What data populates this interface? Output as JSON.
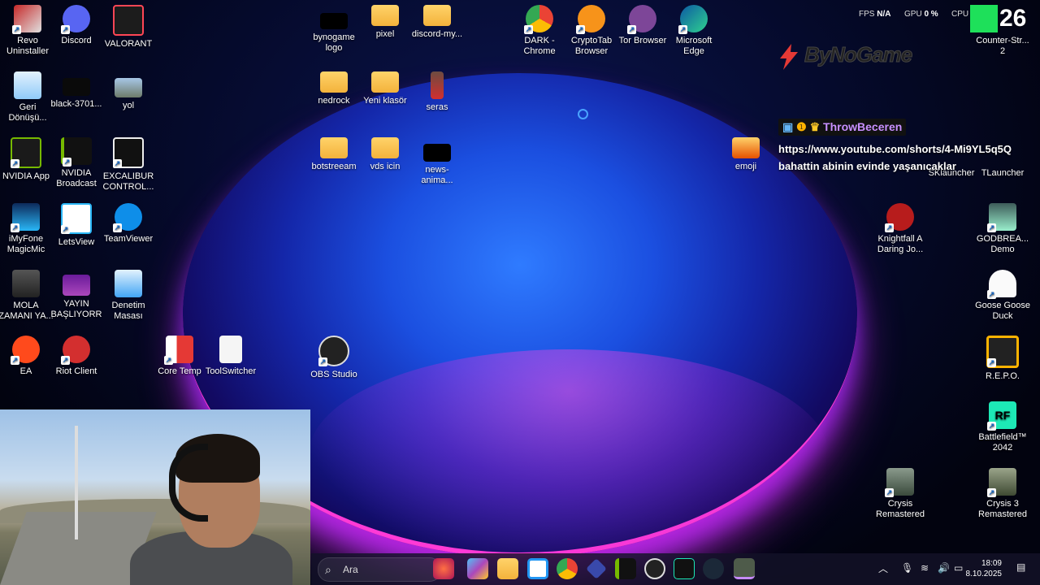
{
  "hud": {
    "fps_label": "FPS",
    "fps_value": "N/A",
    "gpu_label": "GPU",
    "gpu_value": "0 %",
    "cpu_label": "CPU",
    "counter_value": "26"
  },
  "brand": {
    "text": "ByNoGame"
  },
  "chat": {
    "username": "ThrowBeceren",
    "message_line1": "https://www.youtube.com/shorts/4-Mi9YL5q5Q",
    "message_line2": "bahattin abinin evinde yaşanıcaklar"
  },
  "desktop_icons": {
    "revo": "Revo\nUninstaller",
    "discord": "Discord",
    "valorant": "VALORANT",
    "recycle": "Geri\nDönüşü...",
    "black": "black-3701...",
    "yol": "yol",
    "nvidia_app": "NVIDIA App",
    "nvidia_broadcast": "NVIDIA\nBroadcast",
    "excalibur": "EXCALIBUR\nCONTROL...",
    "imyfone": "iMyFone\nMagicMic",
    "letsview": "LetsView",
    "teamviewer": "TeamViewer",
    "mola": "MOLA\nZAMANI YA...",
    "yayin": "YAYIN\nBAŞLIYORR",
    "denetim": "Denetim\nMasası",
    "ea": "EA",
    "riot": "Riot Client",
    "coretemp": "Core Temp",
    "toolswitcher": "ToolSwitcher",
    "obs": "OBS Studio",
    "bynogame_logo": "bynogame\nlogo",
    "pixel": "pixel",
    "discord_my": "discord-my...",
    "nedrock": "nedrock",
    "yeni_klasor": "Yeni klasör",
    "seras": "seras",
    "botstreeam": "botstreeam",
    "vds_icin": "vds icin",
    "news_anima": "news-anima...",
    "dark_chrome": "DARK -\nChrome",
    "cryptotab": "CryptoTab\nBrowser",
    "tor": "Tor Browser",
    "edge": "Microsoft\nEdge",
    "emoji": "emoji",
    "counter_strike": "Counter-Str...\n2",
    "sklauncher": "SKlauncher",
    "tlauncher": "TLauncher",
    "knightfall": "Knightfall A\nDaring Jo...",
    "godbreakers": "GODBREA...\nDemo",
    "goose": "Goose Goose\nDuck",
    "repo": "R.E.P.O.",
    "battlefield": "Battlefield™\n2042",
    "crysis": "Crysis\nRemastered",
    "crysis3": "Crysis 3\nRemastered"
  },
  "taskbar": {
    "search_placeholder": "Ara",
    "time": "18:09",
    "date": "8.10.2025"
  },
  "colors": {
    "accent": "#2f7bff",
    "chat_name": "#c890ff"
  }
}
